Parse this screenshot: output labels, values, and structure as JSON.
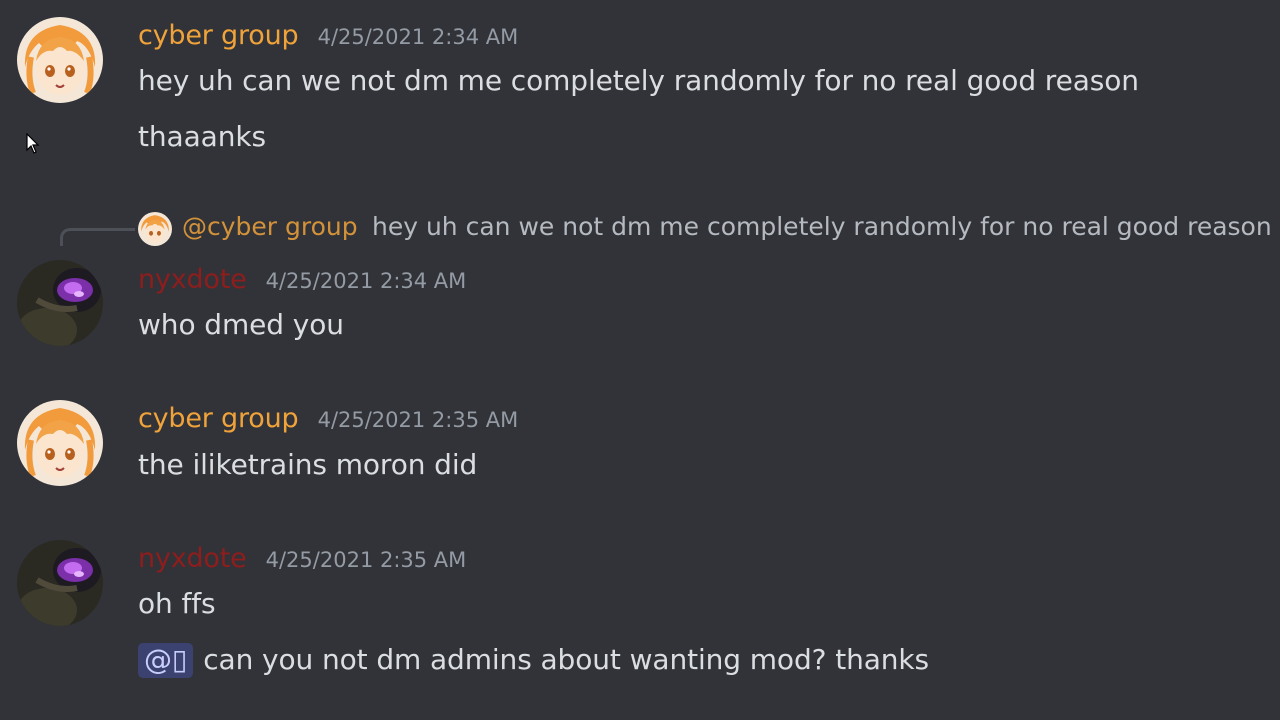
{
  "messages": [
    {
      "author": "cyber group",
      "timestamp": "4/25/2021 2:34 AM",
      "lines": [
        "hey uh can we not dm me completely randomly for no real good reason",
        "thaaanks"
      ]
    },
    {
      "reply": {
        "name": "@cyber group",
        "text": "hey uh can we not dm me completely randomly for no real good reason"
      },
      "author": "nyxdote",
      "timestamp": "4/25/2021 2:34 AM",
      "lines": [
        "who dmed you"
      ]
    },
    {
      "author": "cyber group",
      "timestamp": "4/25/2021 2:35 AM",
      "lines": [
        "the iliketrains moron did"
      ]
    },
    {
      "author": "nyxdote",
      "timestamp": "4/25/2021 2:35 AM",
      "lines": [
        "oh ffs"
      ],
      "mention": "@▯",
      "mention_line": "can you not dm admins about wanting mod? thanks"
    }
  ],
  "colors": {
    "background": "#313338",
    "cyber_name": "#f0a33a",
    "red_name": "#8e1d1d",
    "timestamp": "#949ba4",
    "text": "#dbdee1",
    "mention_bg": "#3c4270"
  },
  "icons": [
    "anime-avatar-icon",
    "dark-avatar-icon",
    "mouse-cursor-icon"
  ]
}
